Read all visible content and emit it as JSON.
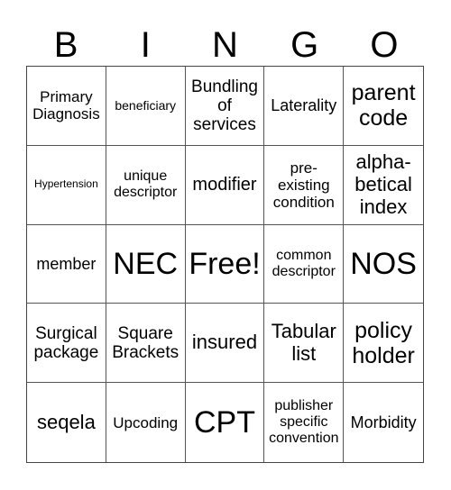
{
  "header": {
    "letters": [
      "B",
      "I",
      "N",
      "G",
      "O"
    ]
  },
  "board": {
    "rows": [
      [
        "Primary Diagnosis",
        "beneficiary",
        "Bundling of services",
        "Laterality",
        "parent code"
      ],
      [
        "Hypertension",
        "unique descriptor",
        "modifier",
        "pre-existing condition",
        "alpha-betical index"
      ],
      [
        "member",
        "NEC",
        "Free!",
        "common descriptor",
        "NOS"
      ],
      [
        "Surgical package",
        "Square Brackets",
        "insured",
        "Tabular list",
        "policy holder"
      ],
      [
        "seqela",
        "Upcoding",
        "CPT",
        "publisher specific convention",
        "Morbidity"
      ]
    ],
    "free_space": "Free!"
  }
}
